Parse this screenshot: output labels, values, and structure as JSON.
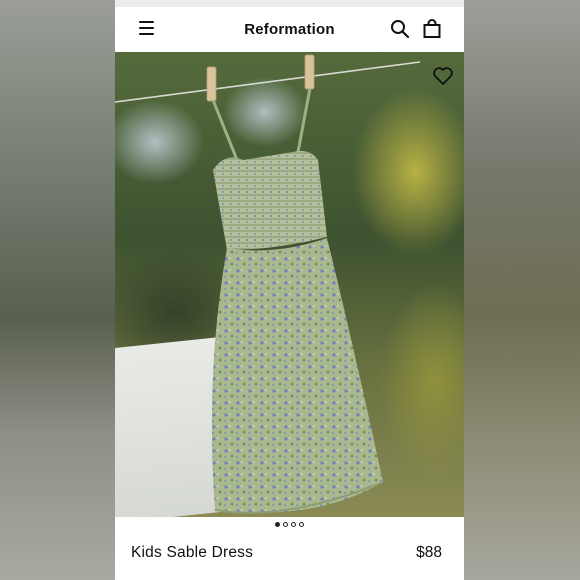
{
  "header": {
    "brand": "Reformation",
    "menu_icon": "hamburger-icon",
    "search_icon": "search-icon",
    "bag_icon": "shopping-bag-icon"
  },
  "hero": {
    "favorite_icon": "heart-icon",
    "carousel": {
      "total": 4,
      "active_index": 0
    }
  },
  "product": {
    "name": "Kids Sable Dress",
    "price": "$88"
  }
}
